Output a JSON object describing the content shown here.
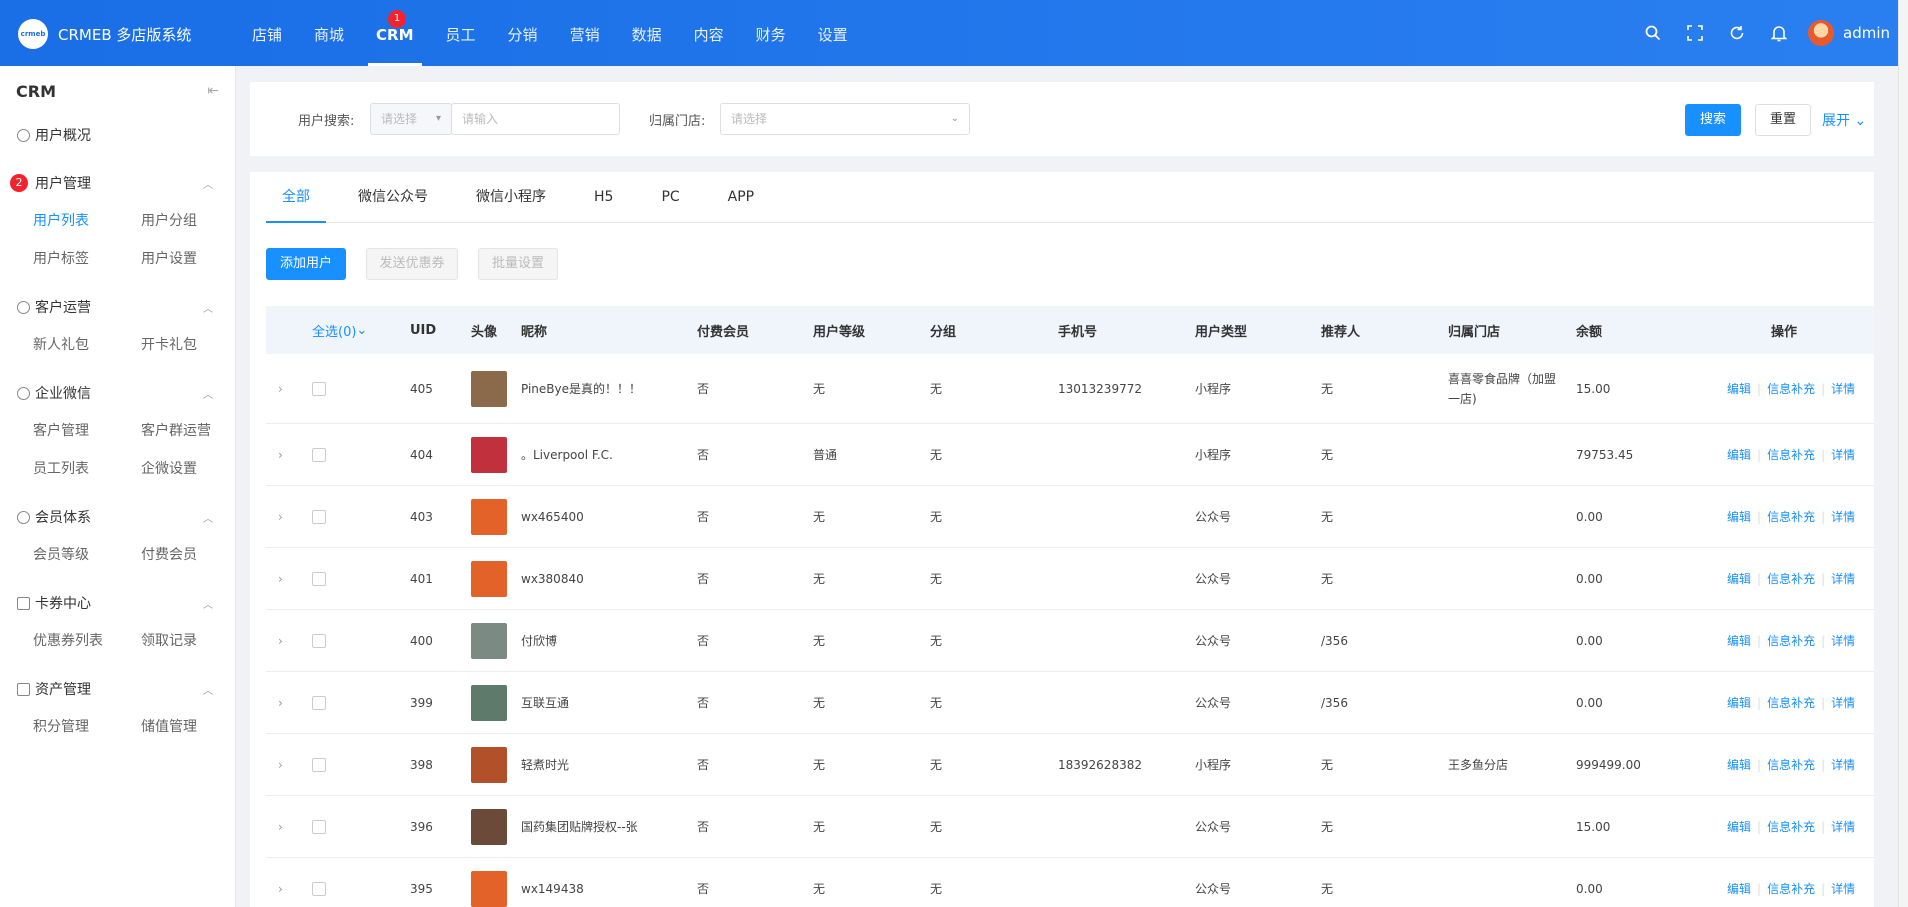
{
  "header": {
    "brand": "CRMEB 多店版系统",
    "logo_text": "crmeb",
    "nav": [
      {
        "label": "店铺"
      },
      {
        "label": "商城"
      },
      {
        "label": "CRM",
        "active": true,
        "badge": "1"
      },
      {
        "label": "员工"
      },
      {
        "label": "分销"
      },
      {
        "label": "营销"
      },
      {
        "label": "数据"
      },
      {
        "label": "内容"
      },
      {
        "label": "财务"
      },
      {
        "label": "设置"
      }
    ],
    "user": "admin",
    "icons": [
      "search-icon",
      "fullscreen-icon",
      "refresh-icon",
      "bell-icon"
    ]
  },
  "sidebar": {
    "title": "CRM",
    "groups": [
      {
        "label": "用户概况",
        "icon": "dashboard-icon",
        "items": []
      },
      {
        "label": "用户管理",
        "badge": "2",
        "icon": "user-icon",
        "items": [
          {
            "label": "用户列表",
            "active": true
          },
          {
            "label": "用户分组"
          },
          {
            "label": "用户标签"
          },
          {
            "label": "用户设置"
          }
        ]
      },
      {
        "label": "客户运营",
        "icon": "funnel-icon",
        "items": [
          {
            "label": "新人礼包"
          },
          {
            "label": "开卡礼包"
          }
        ]
      },
      {
        "label": "企业微信",
        "icon": "wechat-icon",
        "items": [
          {
            "label": "客户管理"
          },
          {
            "label": "客户群运营"
          },
          {
            "label": "员工列表"
          },
          {
            "label": "企微设置"
          }
        ]
      },
      {
        "label": "会员体系",
        "icon": "member-icon",
        "items": [
          {
            "label": "会员等级"
          },
          {
            "label": "付费会员"
          }
        ]
      },
      {
        "label": "卡券中心",
        "icon": "card-icon",
        "items": [
          {
            "label": "优惠券列表"
          },
          {
            "label": "领取记录"
          }
        ]
      },
      {
        "label": "资产管理",
        "icon": "wallet-icon",
        "items": [
          {
            "label": "积分管理"
          },
          {
            "label": "储值管理"
          }
        ]
      }
    ]
  },
  "search": {
    "user_search_label": "用户搜索:",
    "type_placeholder": "请选择",
    "keyword_placeholder": "请输入",
    "store_label": "归属门店:",
    "store_placeholder": "请选择",
    "search_btn": "搜索",
    "reset_btn": "重置",
    "expand_link": "展开"
  },
  "tabs": [
    {
      "label": "全部",
      "active": true
    },
    {
      "label": "微信公众号"
    },
    {
      "label": "微信小程序"
    },
    {
      "label": "H5"
    },
    {
      "label": "PC"
    },
    {
      "label": "APP"
    }
  ],
  "actions": {
    "add_user": "添加用户",
    "send_coupon": "发送优惠券",
    "batch_set": "批量设置"
  },
  "table": {
    "headers": {
      "select_all": "全选(0)",
      "uid": "UID",
      "avatar": "头像",
      "nickname": "昵称",
      "paid_member": "付费会员",
      "level": "用户等级",
      "group": "分组",
      "phone": "手机号",
      "type": "用户类型",
      "referrer": "推荐人",
      "store": "归属门店",
      "balance": "余额",
      "ops": "操作"
    },
    "op_labels": {
      "edit": "编辑",
      "supplement": "信息补充",
      "detail": "详情"
    },
    "rows": [
      {
        "uid": "405",
        "avatar_color": "#8a6a4a",
        "nickname": "PineBye是真的！！！",
        "paid": "否",
        "level": "无",
        "group": "无",
        "phone": "13013239772",
        "type": "小程序",
        "referrer": "无",
        "store": "喜喜零食品牌（加盟一店)",
        "balance": "15.00"
      },
      {
        "uid": "404",
        "avatar_color": "#c0313d",
        "nickname": "。Liverpool F.C.",
        "paid": "否",
        "level": "普通",
        "group": "无",
        "phone": "",
        "type": "小程序",
        "referrer": "无",
        "store": "",
        "balance": "79753.45"
      },
      {
        "uid": "403",
        "avatar_color": "#e3622a",
        "nickname": "wx465400",
        "paid": "否",
        "level": "无",
        "group": "无",
        "phone": "",
        "type": "公众号",
        "referrer": "无",
        "store": "",
        "balance": "0.00"
      },
      {
        "uid": "401",
        "avatar_color": "#e3622a",
        "nickname": "wx380840",
        "paid": "否",
        "level": "无",
        "group": "无",
        "phone": "",
        "type": "公众号",
        "referrer": "无",
        "store": "",
        "balance": "0.00"
      },
      {
        "uid": "400",
        "avatar_color": "#7c8a84",
        "nickname": "付欣博",
        "paid": "否",
        "level": "无",
        "group": "无",
        "phone": "",
        "type": "公众号",
        "referrer": "/356",
        "store": "",
        "balance": "0.00"
      },
      {
        "uid": "399",
        "avatar_color": "#5d7a6a",
        "nickname": "互联互通",
        "paid": "否",
        "level": "无",
        "group": "无",
        "phone": "",
        "type": "公众号",
        "referrer": "/356",
        "store": "",
        "balance": "0.00"
      },
      {
        "uid": "398",
        "avatar_color": "#b2502a",
        "nickname": "轻煮时光",
        "paid": "否",
        "level": "无",
        "group": "无",
        "phone": "18392628382",
        "type": "小程序",
        "referrer": "无",
        "store": "王多鱼分店",
        "balance": "999499.00"
      },
      {
        "uid": "396",
        "avatar_color": "#6b4a3a",
        "nickname": "国药集团贴牌授权--张",
        "paid": "否",
        "level": "无",
        "group": "无",
        "phone": "",
        "type": "公众号",
        "referrer": "无",
        "store": "",
        "balance": "15.00"
      },
      {
        "uid": "395",
        "avatar_color": "#e3622a",
        "nickname": "wx149438",
        "paid": "否",
        "level": "无",
        "group": "无",
        "phone": "",
        "type": "公众号",
        "referrer": "无",
        "store": "",
        "balance": "0.00"
      }
    ]
  }
}
